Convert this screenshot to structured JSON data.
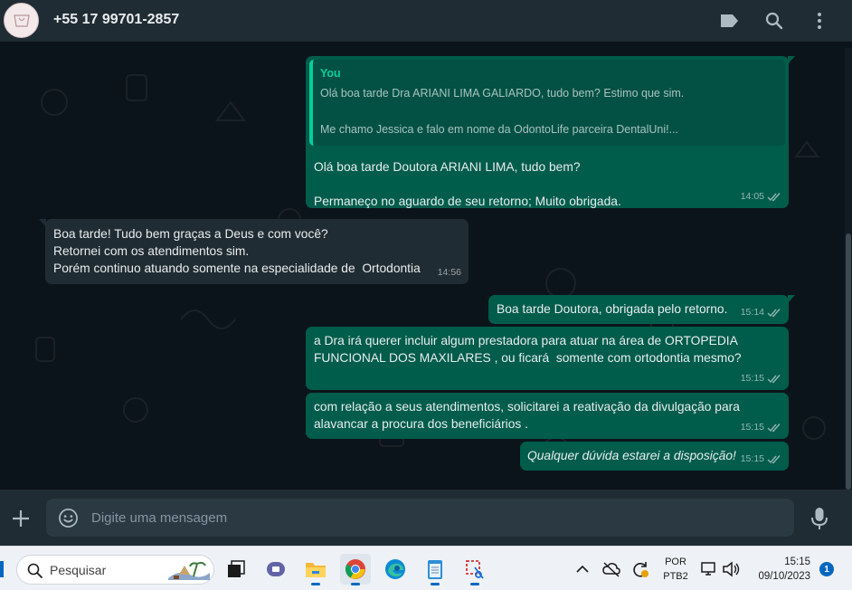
{
  "header": {
    "contact_name": "+55 17 99701-2857",
    "icons": [
      "avatar",
      "label-icon",
      "search-icon",
      "more-vertical-icon"
    ]
  },
  "messages": [
    {
      "direction": "outgoing",
      "quote": {
        "author": "You",
        "text": "Olá boa tarde Dra ARIANI LIMA GALIARDO, tudo bem? Estimo que sim.\n\nMe chamo Jessica e falo em nome da OdontoLife parceira DentalUni!..."
      },
      "text": "Olá boa tarde Doutora ARIANI LIMA, tudo bem?\n\nPermaneço no aguardo de seu retorno; Muito obrigada.",
      "time": "14:05",
      "status": "read"
    },
    {
      "direction": "incoming",
      "text": "Boa tarde! Tudo bem graças a Deus e com você?\nRetornei com os atendimentos sim.\nPorém continuo atuando somente na especialidade de  Ortodontia",
      "time": "14:56"
    },
    {
      "direction": "outgoing",
      "text": "Boa tarde Doutora, obrigada pelo retorno.",
      "time": "15:14",
      "status": "read"
    },
    {
      "direction": "outgoing",
      "text": "a Dra irá querer incluir algum prestadora para atuar na área de ORTOPEDIA\nFUNCIONAL DOS MAXILARES , ou ficará  somente com ortodontia mesmo?",
      "time": "15:15",
      "status": "read"
    },
    {
      "direction": "outgoing",
      "text": "com relação a seus atendimentos, solicitarei a reativação da divulgação para\nalavancar a procura dos beneficiários .",
      "time": "15:15",
      "status": "read"
    },
    {
      "direction": "outgoing",
      "text": "Qualquer dúvida estarei a disposição!",
      "italic": true,
      "time": "15:15",
      "status": "read"
    }
  ],
  "composer": {
    "placeholder": "Digite uma mensagem"
  },
  "taskbar": {
    "search_placeholder": "Pesquisar",
    "apps": [
      "task-view-icon",
      "teams-icon",
      "file-explorer-icon",
      "chrome-icon",
      "edge-icon",
      "notepad-icon",
      "snipping-tool-icon"
    ],
    "active_app": "chrome-icon",
    "language": "POR",
    "keyboard": "PTB2",
    "time": "15:15",
    "date": "09/10/2023",
    "notification_count": "1"
  },
  "colors": {
    "header_bg": "#202c33",
    "chat_bg": "#0b141a",
    "outgoing_bubble": "#005c4b",
    "incoming_bubble": "#202c33",
    "quote_accent": "#06cf9c",
    "taskbar_accent": "#0067c0"
  }
}
